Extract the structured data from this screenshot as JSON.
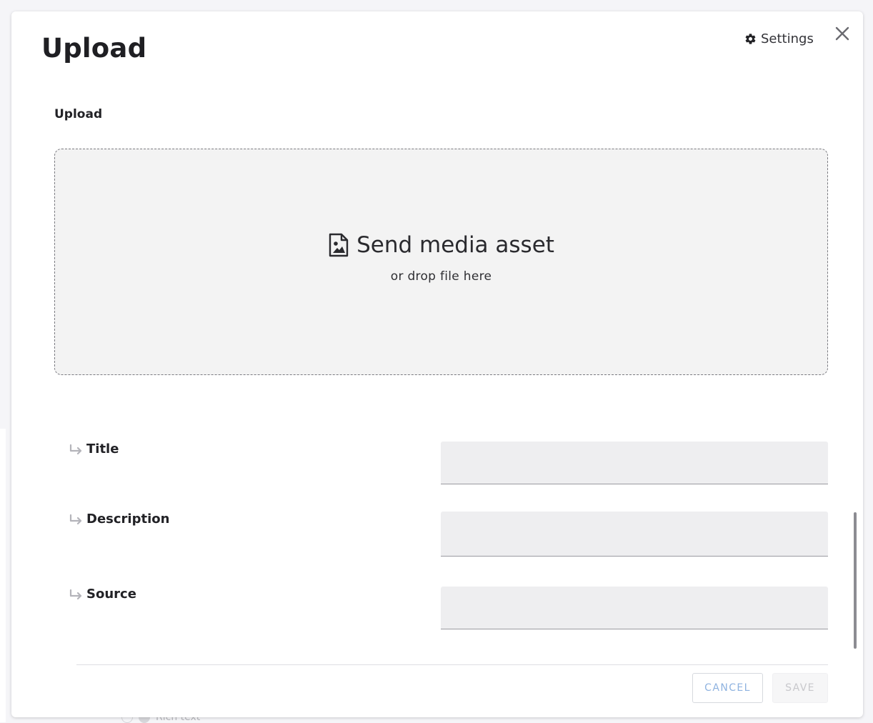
{
  "modal": {
    "title": "Upload",
    "settings_label": "Settings"
  },
  "upload_section": {
    "label": "Upload",
    "dropzone_main": "Send media asset",
    "dropzone_sub": "or drop file here"
  },
  "fields": [
    {
      "label": "Title",
      "value": ""
    },
    {
      "label": "Description",
      "value": ""
    },
    {
      "label": "Source",
      "value": ""
    }
  ],
  "footer": {
    "cancel_label": "CANCEL",
    "save_label": "SAVE"
  },
  "background": {
    "peek_text": "Rich text"
  },
  "icons": {
    "settings": "gear-icon",
    "close": "close-icon",
    "dropzone": "image-file-icon",
    "field": "arrow-return-right-icon"
  },
  "colors": {
    "cancel_text": "#8fb3e0",
    "save_text": "#c8c8cc",
    "dropzone_bg": "#f3f3f3",
    "input_bg": "#eeeef0"
  }
}
